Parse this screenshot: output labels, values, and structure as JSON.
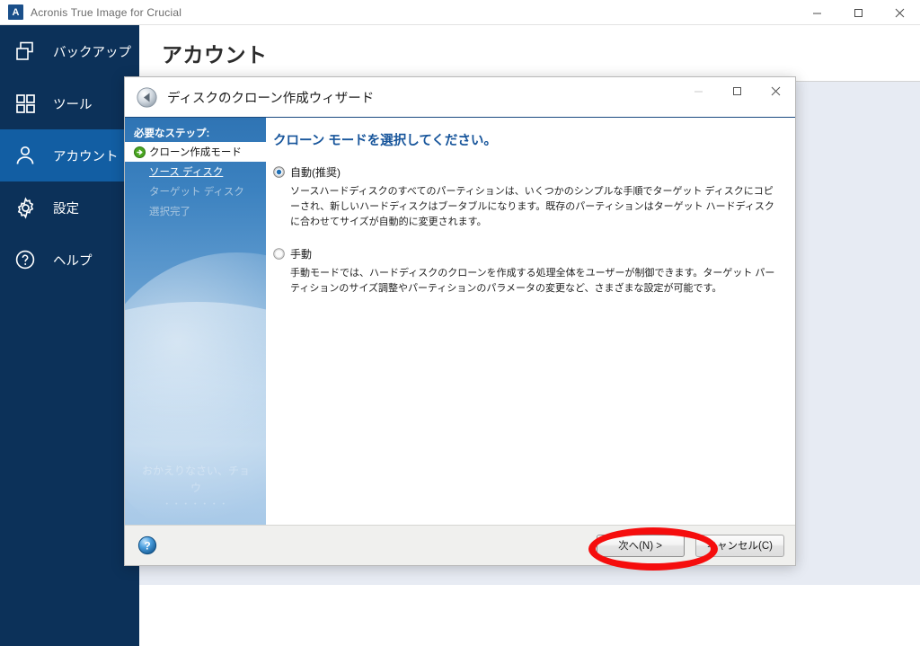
{
  "window": {
    "app_title": "Acronis True Image for Crucial",
    "logo_letter": "A",
    "controls": {
      "minimize": "minimize-icon",
      "maximize": "maximize-icon",
      "close": "close-icon"
    }
  },
  "sidebar": {
    "items": [
      {
        "label": "バックアップ",
        "icon": "backup-copies-icon",
        "selected": false
      },
      {
        "label": "ツール",
        "icon": "tools-grid-icon",
        "selected": false
      },
      {
        "label": "アカウント",
        "icon": "account-person-icon",
        "selected": true
      },
      {
        "label": "設定",
        "icon": "settings-gear-icon",
        "selected": false
      },
      {
        "label": "ヘルプ",
        "icon": "help-question-icon",
        "selected": false
      }
    ]
  },
  "page": {
    "title": "アカウント"
  },
  "dialog": {
    "title": "ディスクのクローン作成ウィザード",
    "back_icon": "back-arrow-icon",
    "controls": {
      "minimize": "minimize-icon",
      "maximize": "maximize-icon",
      "close": "close-icon"
    },
    "steps": {
      "header": "必要なステップ:",
      "items": [
        {
          "label": "クローン作成モード",
          "state": "current",
          "icon": "green-arrow-icon"
        },
        {
          "label": "ソース ディスク",
          "state": "link"
        },
        {
          "label": "ターゲット ディスク",
          "state": "disabled"
        },
        {
          "label": "選択完了",
          "state": "disabled"
        }
      ],
      "watermark_line1": "おかえりなさい、チョウ",
      "watermark_line2": "・・・・・・・"
    },
    "content": {
      "heading": "クローン モードを選択してください。",
      "options": [
        {
          "label": "自動(推奨)",
          "selected": true,
          "description": "ソースハードディスクのすべてのパーティションは、いくつかのシンプルな手順でターゲット ディスクにコピーされ、新しいハードディスクはブータブルになります。既存のパーティションはターゲット ハードディスクに合わせてサイズが自動的に変更されます。"
        },
        {
          "label": "手動",
          "selected": false,
          "description": "手動モードでは、ハードディスクのクローンを作成する処理全体をユーザーが制御できます。ターゲット パーティションのサイズ調整やパーティションのパラメータの変更など、さまざまな設定が可能です。"
        }
      ]
    },
    "footer": {
      "help_icon": "help-globe-icon",
      "next_label": "次へ(N) >",
      "cancel_label": "キャンセル(C)"
    }
  },
  "annotation": {
    "shape": "red-ellipse-highlight",
    "target": "next-button",
    "color": "#f50d0d"
  },
  "colors": {
    "sidebar_bg": "#0c3159",
    "sidebar_selected": "#125ea3",
    "content_bg": "#e7ebf3",
    "heading_blue": "#17559b",
    "annotation_red": "#f50d0d"
  }
}
